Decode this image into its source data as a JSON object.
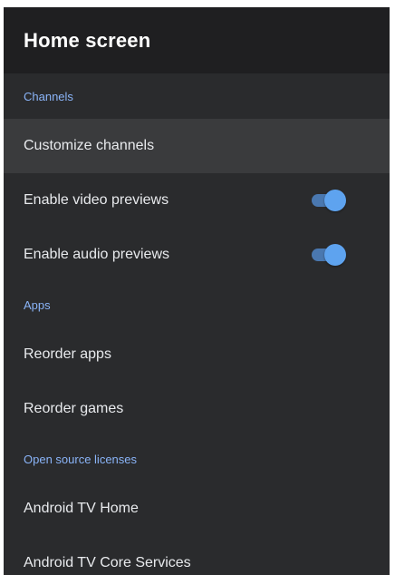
{
  "header": {
    "title": "Home screen"
  },
  "sections": {
    "channels": {
      "label": "Channels",
      "customize": {
        "label": "Customize channels"
      },
      "video_previews": {
        "label": "Enable video previews",
        "enabled": true
      },
      "audio_previews": {
        "label": "Enable audio previews",
        "enabled": true
      }
    },
    "apps": {
      "label": "Apps",
      "reorder_apps": {
        "label": "Reorder apps"
      },
      "reorder_games": {
        "label": "Reorder games"
      }
    },
    "licenses": {
      "label": "Open source licenses",
      "tv_home": {
        "label": "Android TV Home"
      },
      "core_services": {
        "label": "Android TV Core Services"
      }
    }
  },
  "colors": {
    "accent": "#8ab4f8",
    "toggle_on": "#5ea3ef",
    "background": "#2a2b2d",
    "header_background": "#1f1f21",
    "selected_row": "#3a3b3d"
  }
}
